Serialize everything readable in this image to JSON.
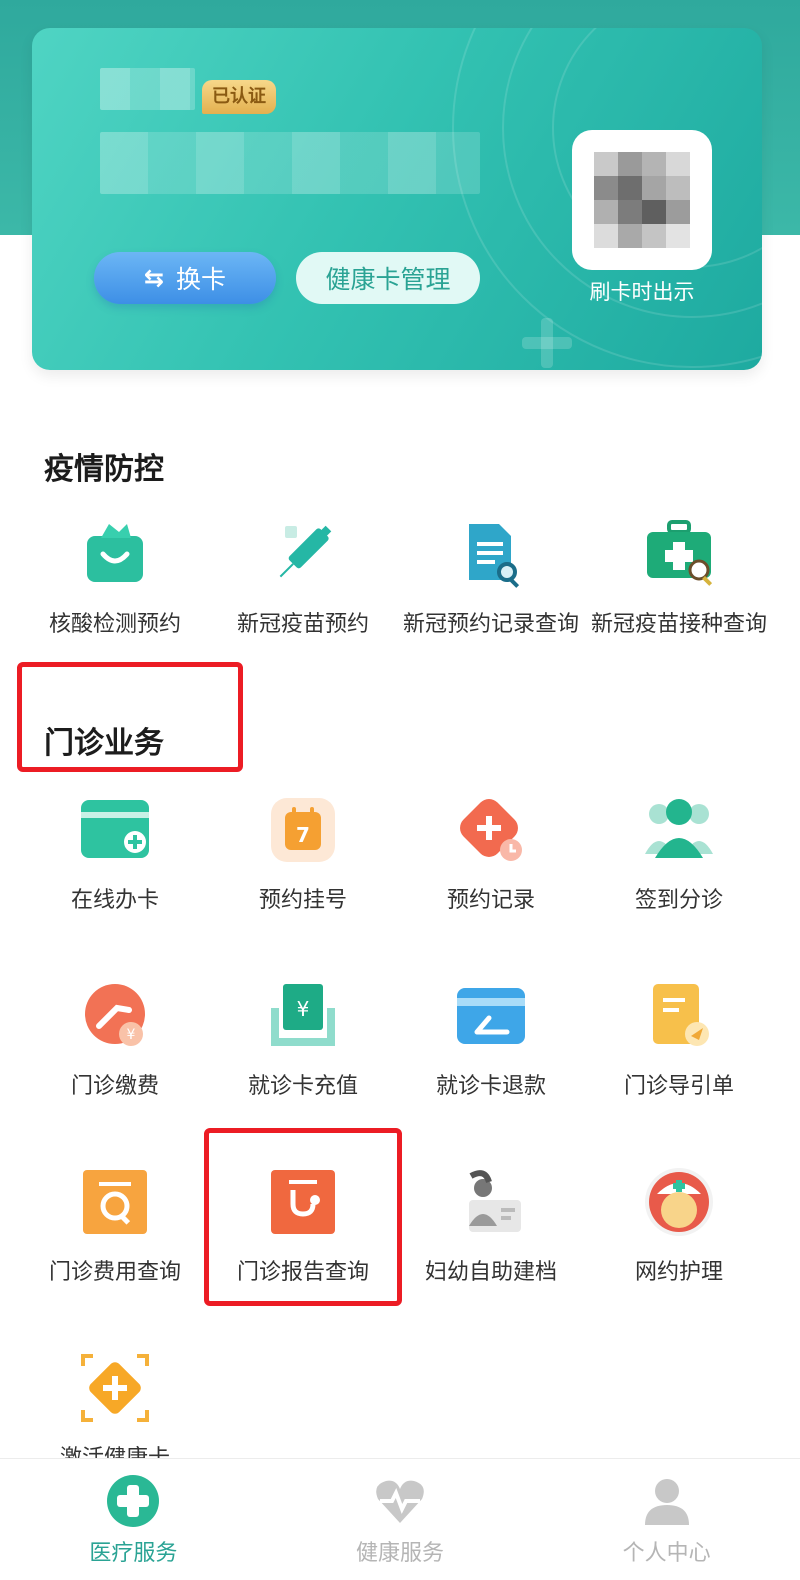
{
  "card": {
    "verified_badge": "已认证",
    "switch_button": "换卡",
    "manage_button": "健康卡管理",
    "qr_caption": "刷卡时出示",
    "switch_icon": "swap-arrows-icon",
    "qr_icon": "qr-code-icon"
  },
  "epidemic": {
    "title": "疫情防控",
    "items": [
      {
        "label": "核酸检测预约",
        "icon": "test-bag-icon"
      },
      {
        "label": "新冠疫苗预约",
        "icon": "syringe-icon"
      },
      {
        "label": "新冠预约记录查询",
        "icon": "document-search-icon"
      },
      {
        "label": "新冠疫苗接种查询",
        "icon": "medical-kit-search-icon"
      }
    ]
  },
  "outpatient": {
    "title": "门诊业务",
    "items": [
      {
        "label": "在线办卡",
        "icon": "card-add-icon"
      },
      {
        "label": "预约挂号",
        "icon": "calendar-icon"
      },
      {
        "label": "预约记录",
        "icon": "record-icon"
      },
      {
        "label": "签到分诊",
        "icon": "people-icon"
      },
      {
        "label": "门诊缴费",
        "icon": "payment-icon"
      },
      {
        "label": "就诊卡充值",
        "icon": "recharge-icon"
      },
      {
        "label": "就诊卡退款",
        "icon": "refund-card-icon"
      },
      {
        "label": "门诊导引单",
        "icon": "guide-sheet-icon"
      },
      {
        "label": "门诊费用查询",
        "icon": "fee-query-icon"
      },
      {
        "label": "门诊报告查询",
        "icon": "stethoscope-report-icon"
      },
      {
        "label": "妇幼自助建档",
        "icon": "maternal-archive-icon"
      },
      {
        "label": "网约护理",
        "icon": "nurse-icon"
      },
      {
        "label": "激活健康卡",
        "icon": "activate-card-icon"
      }
    ]
  },
  "bottom_nav": [
    {
      "label": "医疗服务",
      "icon": "medical-cross-icon",
      "active": true
    },
    {
      "label": "健康服务",
      "icon": "heart-pulse-icon",
      "active": false
    },
    {
      "label": "个人中心",
      "icon": "user-icon",
      "active": false
    }
  ],
  "colors": {
    "brand_teal": "#2bb5a3",
    "highlight_red": "#ec1c24",
    "nav_active": "#2aa394",
    "nav_inactive": "#b5b5b5"
  }
}
